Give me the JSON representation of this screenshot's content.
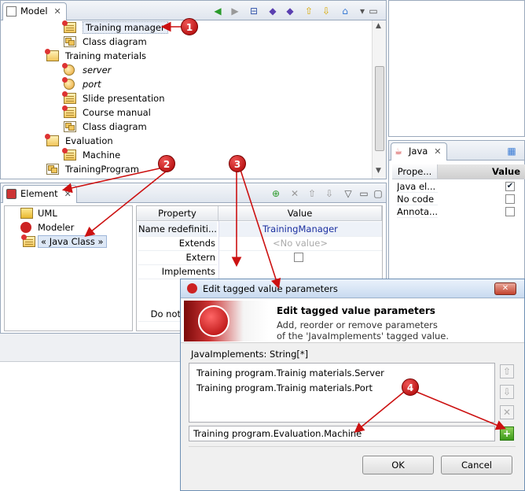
{
  "model_panel": {
    "tab": "Model",
    "toolbar_icons": [
      "back-icon",
      "forward-icon",
      "collapse-icon",
      "link-icon",
      "link2-icon",
      "up-icon",
      "down-icon",
      "home-icon",
      "menu-icon"
    ],
    "tree": [
      {
        "label": "Training manager",
        "icon": "class",
        "selected": true
      },
      {
        "label": "Class diagram",
        "icon": "diagram"
      },
      {
        "label": "Training materials",
        "icon": "package"
      },
      {
        "label": "server",
        "icon": "port",
        "italic": true
      },
      {
        "label": "port",
        "icon": "port",
        "italic": true
      },
      {
        "label": "Slide presentation",
        "icon": "class"
      },
      {
        "label": "Course manual",
        "icon": "class"
      },
      {
        "label": "Class diagram",
        "icon": "diagram"
      },
      {
        "label": "Evaluation",
        "icon": "package"
      },
      {
        "label": "Machine",
        "icon": "class"
      },
      {
        "label": "TrainingProgram",
        "icon": "diagram"
      }
    ]
  },
  "element_panel": {
    "tab": "Element",
    "list": [
      "UML",
      "Modeler",
      "« Java Class »"
    ],
    "table": {
      "headers": [
        "Property",
        "Value"
      ],
      "rows": [
        {
          "property": "Name redefiniti...",
          "value": "TrainingManager"
        },
        {
          "property": "Extends",
          "value": "<No value>"
        },
        {
          "property": "Extern",
          "value": ""
        },
        {
          "property": "Implements",
          "value": ""
        },
        {
          "property": "Do not",
          "value": ""
        }
      ]
    }
  },
  "java_panel": {
    "tab": "Java",
    "headers": [
      "Prope...",
      "Value"
    ],
    "rows": [
      {
        "property": "Java el...",
        "checked": true
      },
      {
        "property": "No code",
        "checked": false
      },
      {
        "property": "Annota...",
        "checked": false
      }
    ]
  },
  "dialog": {
    "title": "Edit tagged value parameters",
    "heading": "Edit tagged value parameters",
    "desc_line1": "Add, reorder or remove parameters",
    "desc_line2": "of the 'JavaImplements' tagged value.",
    "list_label": "JavaImplements: String[*]",
    "items": [
      "Training program.Trainig materials.Server",
      "Training program.Trainig materials.Port"
    ],
    "input_value": "Training program.Evaluation.Machine",
    "ok": "OK",
    "cancel": "Cancel"
  },
  "callouts": [
    "1",
    "2",
    "3",
    "4"
  ],
  "colors": {
    "callout": "#cc1111",
    "link_value": "#1a2fa0",
    "panel_border": "#9aa9bc"
  }
}
